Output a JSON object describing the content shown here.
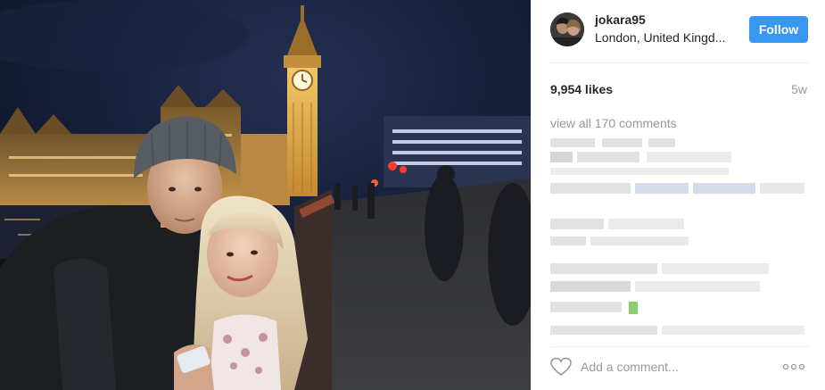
{
  "post": {
    "username": "jokara95",
    "location": "London, United Kingd...",
    "follow_label": "Follow",
    "likes": "9,954 likes",
    "time_ago": "5w",
    "view_all_comments": "view all 170 comments",
    "comment_placeholder": "Add a comment..."
  },
  "icons": {
    "like": "heart-icon",
    "more": "more-options-icon"
  },
  "colors": {
    "follow_button": "#3897f0",
    "text_primary": "#262626",
    "text_secondary": "#999999"
  }
}
